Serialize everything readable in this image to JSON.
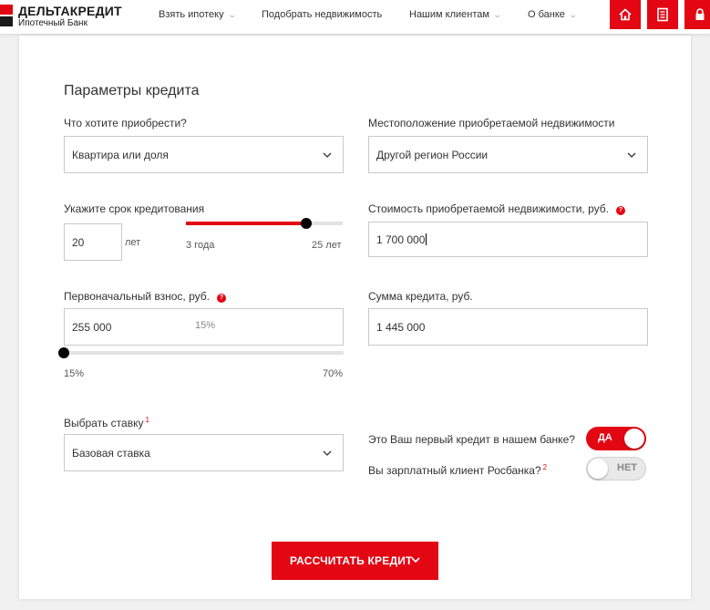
{
  "header": {
    "logo_title": "ДЕЛЬТАКРЕДИТ",
    "logo_subtitle": "Ипотечный Банк",
    "nav": [
      {
        "label": "Взять ипотеку",
        "has_chevron": true
      },
      {
        "label": "Подобрать недвижимость",
        "has_chevron": false
      },
      {
        "label": "Нашим клиентам",
        "has_chevron": true
      },
      {
        "label": "О банке",
        "has_chevron": true
      }
    ],
    "icons": [
      "home-icon",
      "document-icon",
      "lock-icon"
    ]
  },
  "form": {
    "title": "Параметры кредита",
    "purchase": {
      "label": "Что хотите приобрести?",
      "value": "Квартира или доля"
    },
    "location": {
      "label": "Местоположение приобретаемой недвижимости",
      "value": "Другой регион России"
    },
    "term": {
      "label": "Укажите срок кредитования",
      "value": "20",
      "unit": "лет",
      "min_label": "3 года",
      "max_label": "25 лет",
      "slider_fraction": 0.77
    },
    "property_cost": {
      "label": "Стоимость приобретаемой недвижимости, руб.",
      "help": "?",
      "value": "1 700 000"
    },
    "down_payment": {
      "label": "Первоначальный взнос, руб.",
      "help": "?",
      "value": "255 000",
      "percent": "15%",
      "min_label": "15%",
      "max_label": "70%",
      "slider_fraction": 0
    },
    "loan_amount": {
      "label": "Сумма кредита, руб.",
      "value": "1 445 000"
    },
    "rate": {
      "label": "Выбрать ставку",
      "footnote": "1",
      "value": "Базовая ставка"
    },
    "first_credit": {
      "label": "Это Ваш первый кредит в нашем банке?",
      "toggle_label": "ДА",
      "on": true
    },
    "salary_client": {
      "label": "Вы зарплатный клиент Росбанка?",
      "footnote": "2",
      "toggle_label": "НЕТ",
      "on": false
    },
    "submit_label": "РАССЧИТАТЬ КРЕДИТ"
  },
  "colors": {
    "accent": "#e30613",
    "text": "#333333",
    "border": "#c9c9c9",
    "track": "#e3e3e3",
    "background": "#f1f1f1"
  }
}
